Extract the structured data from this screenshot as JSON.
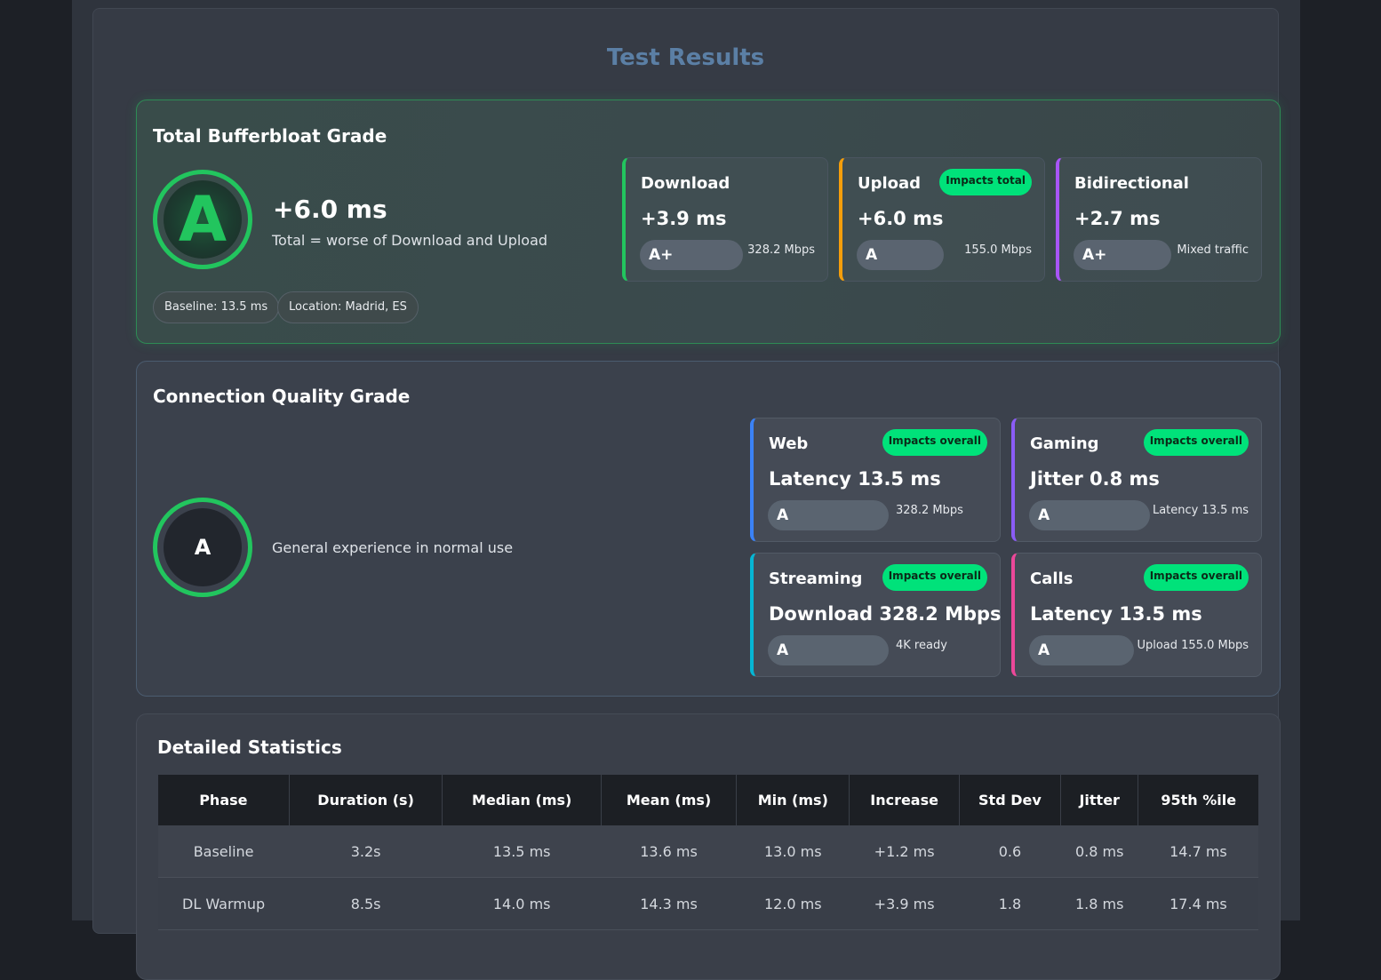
{
  "page": {
    "title": "Test Results"
  },
  "bufferbloat": {
    "title": "Total Bufferbloat Grade",
    "grade": "A",
    "value": "+6.0 ms",
    "description": "Total = worse of Download and Upload",
    "baseline": "Baseline: 13.5 ms",
    "location": "Location: Madrid, ES",
    "colors": {
      "ring": "#22c55e"
    },
    "cards": [
      {
        "title": "Download",
        "value": "+3.9 ms",
        "grade": "A+",
        "note": "328.2 Mbps",
        "badge": "",
        "accent": "#22c55e"
      },
      {
        "title": "Upload",
        "value": "+6.0 ms",
        "grade": "A",
        "note": "155.0 Mbps",
        "badge": "Impacts total",
        "accent": "#f59e0b"
      },
      {
        "title": "Bidirectional",
        "value": "+2.7 ms",
        "grade": "A+",
        "note": "Mixed traffic",
        "badge": "",
        "accent": "#a855f7"
      }
    ]
  },
  "connection": {
    "title": "Connection Quality Grade",
    "grade": "A",
    "description": "General experience in normal use",
    "cards": [
      {
        "title": "Web",
        "value": "Latency 13.5 ms",
        "grade": "A",
        "note": "328.2 Mbps",
        "badge": "Impacts overall",
        "accent": "#3b82f6"
      },
      {
        "title": "Gaming",
        "value": "Jitter 0.8 ms",
        "grade": "A",
        "note": "Latency 13.5 ms",
        "badge": "Impacts overall",
        "accent": "#8b5cf6"
      },
      {
        "title": "Streaming",
        "value": "Download 328.2 Mbps",
        "grade": "A",
        "note": "4K ready",
        "badge": "Impacts overall",
        "accent": "#06b6d4"
      },
      {
        "title": "Calls",
        "value": "Latency 13.5 ms",
        "grade": "A",
        "note": "Upload 155.0 Mbps",
        "badge": "Impacts overall",
        "accent": "#ec4899"
      }
    ]
  },
  "stats": {
    "title": "Detailed Statistics",
    "headers": [
      "Phase",
      "Duration (s)",
      "Median (ms)",
      "Mean (ms)",
      "Min (ms)",
      "Increase",
      "Std Dev",
      "Jitter",
      "95th %ile"
    ],
    "rows": [
      [
        "Baseline",
        "3.2s",
        "13.5 ms",
        "13.6 ms",
        "13.0 ms",
        "+1.2 ms",
        "0.6",
        "0.8 ms",
        "14.7 ms"
      ],
      [
        "DL Warmup",
        "8.5s",
        "14.0 ms",
        "14.3 ms",
        "12.0 ms",
        "+3.9 ms",
        "1.8",
        "1.8 ms",
        "17.4 ms"
      ]
    ]
  }
}
